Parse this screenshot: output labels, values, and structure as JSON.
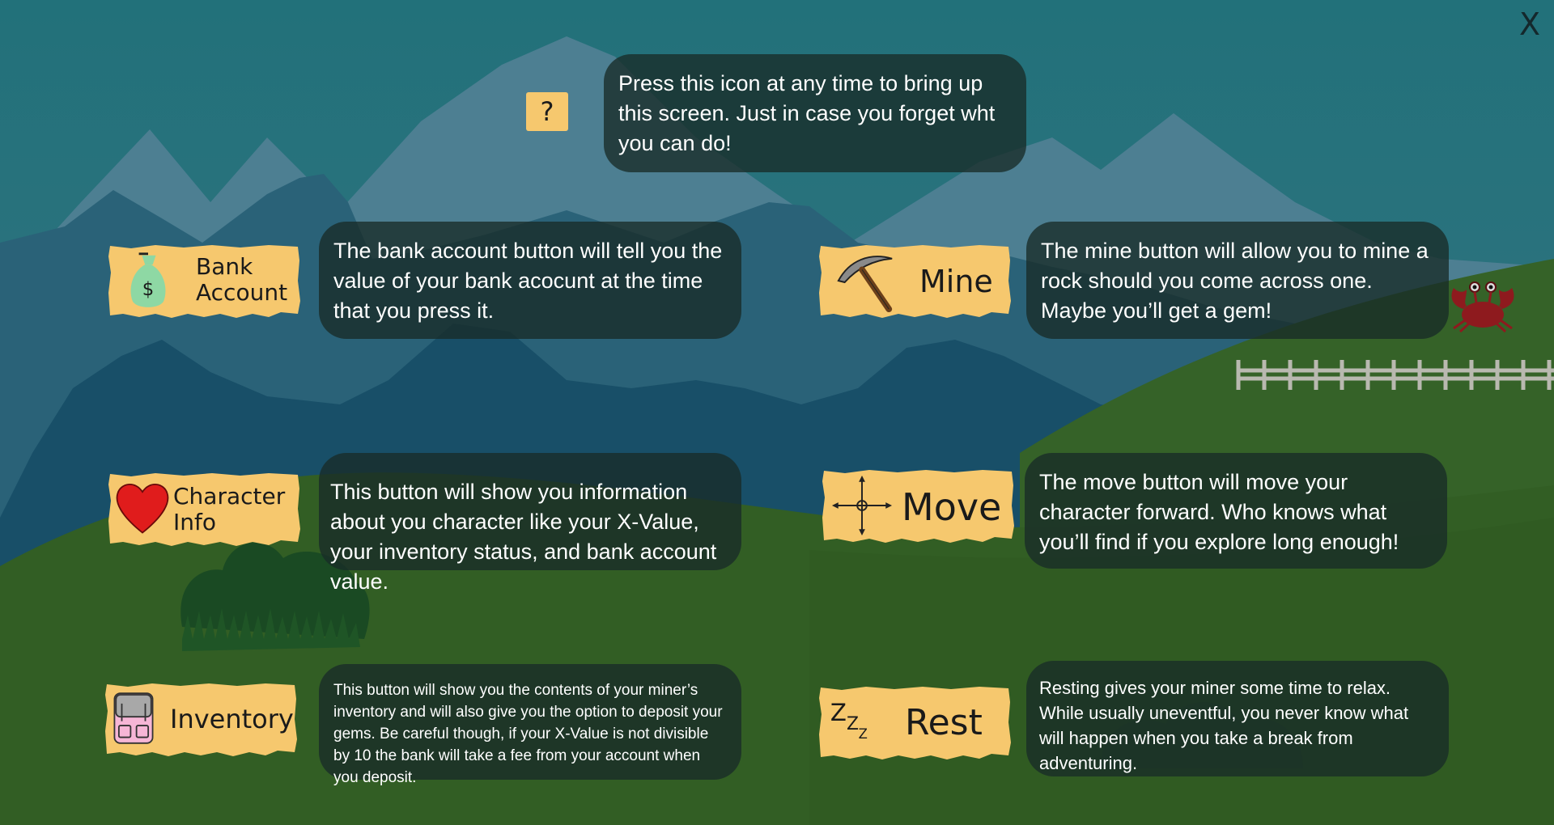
{
  "close": {
    "label": "X"
  },
  "help": {
    "icon_label": "?",
    "text": "Press this icon at any time to bring up this screen. Just in case you forget wht you can do!"
  },
  "buttons": {
    "bank": {
      "line1": "Bank",
      "line2": "Account",
      "icon": "money-bag-icon",
      "icon_text": "$"
    },
    "mine": {
      "label": "Mine",
      "icon": "pickaxe-icon"
    },
    "character": {
      "line1": "Character",
      "line2": "Info",
      "icon": "heart-icon"
    },
    "move": {
      "label": "Move",
      "icon": "move-arrows-icon"
    },
    "inventory": {
      "label": "Inventory",
      "icon": "backpack-icon"
    },
    "rest": {
      "label": "Rest",
      "icon": "sleep-zzz-icon",
      "icon_text": [
        "Z",
        "Z",
        "Z"
      ]
    }
  },
  "descriptions": {
    "bank": "The bank account button will tell you the value of your bank acocunt at the time that you press it.",
    "mine": "The mine button will allow you to mine a rock should you come across one. Maybe you’ll get a gem!",
    "character": "This button will show you information about you character like your X-Value, your inventory status, and bank account value.",
    "move": "The move button will move your character forward. Who knows what you’ll find if you explore long enough!",
    "inventory": "This button will show you the contents of your miner’s inventory and will also give you the option to deposit your gems. Be careful though, if your X-Value is not divisible by 10 the bank will take a fee from your account when you deposit.",
    "rest": "Resting gives your miner some time to relax. While usually uneventful, you never know what will happen when you take a break from adventuring."
  },
  "colors": {
    "sky": "#24707a",
    "grass": "#325e24",
    "button_paper": "#f6c86e",
    "bubble": "#182c28"
  }
}
